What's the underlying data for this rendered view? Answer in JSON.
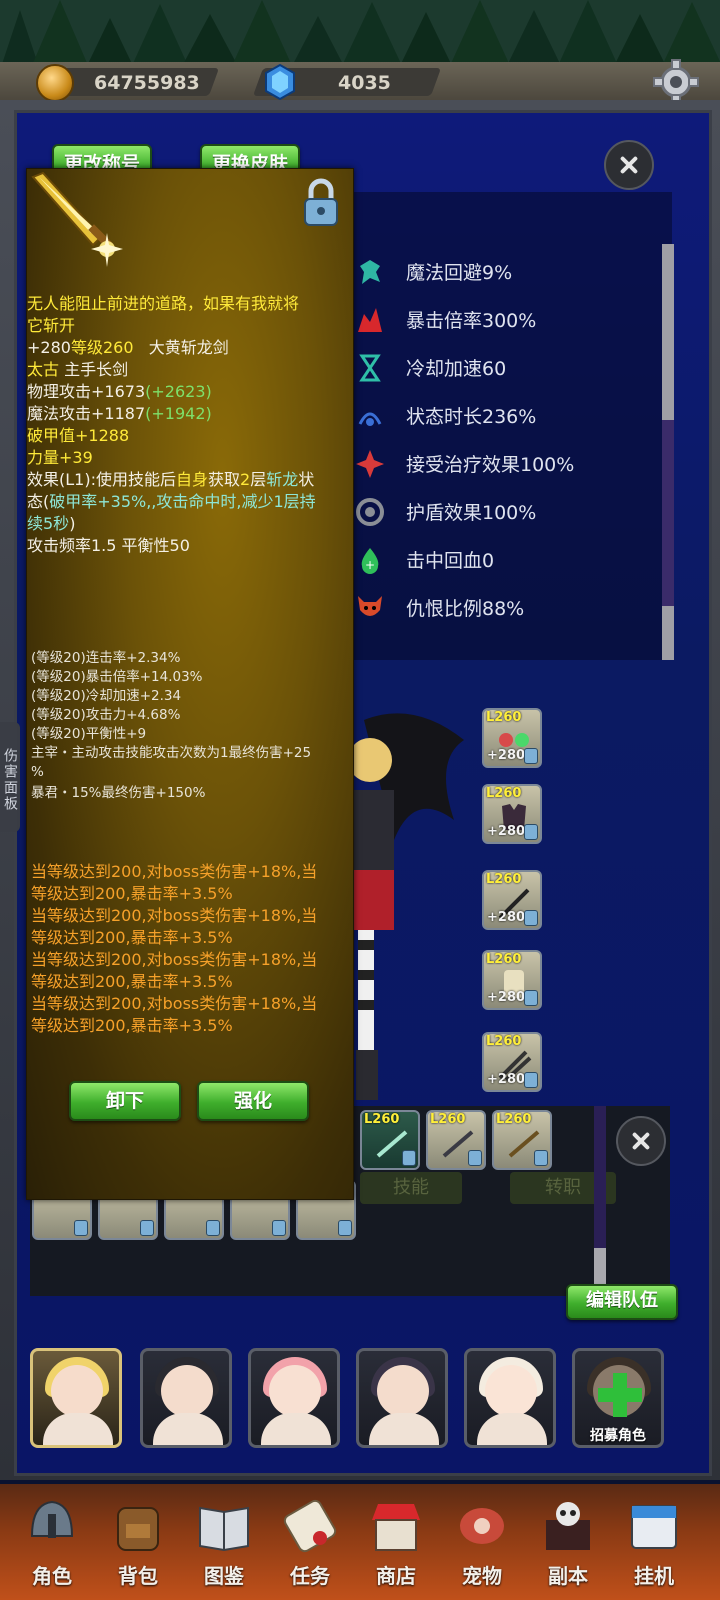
{
  "resources": {
    "gold": "64755983",
    "gems": "4035"
  },
  "side_tab": "伤害面板",
  "header_buttons": {
    "change_title": "更改称号",
    "change_skin": "更换皮肤"
  },
  "stats": [
    {
      "icon": "evade-icon",
      "label": "魔法回避9%",
      "color": "#2fb6a4"
    },
    {
      "icon": "crit-multiplier-icon",
      "label": "暴击倍率300%",
      "color": "#d8282c"
    },
    {
      "icon": "cooldown-icon",
      "label": "冷却加速60",
      "color": "#2fbfa8"
    },
    {
      "icon": "status-duration-icon",
      "label": "状态时长236%",
      "color": "#3a6fd6"
    },
    {
      "icon": "healing-received-icon",
      "label": "接受治疗效果100%",
      "color": "#d83a3a"
    },
    {
      "icon": "shield-effect-icon",
      "label": "护盾效果100%",
      "color": "#8a8e96"
    },
    {
      "icon": "life-on-hit-icon",
      "label": "击中回血0",
      "color": "#2fbf5a"
    },
    {
      "icon": "threat-ratio-icon",
      "label": "仇恨比例88%",
      "color": "#d84a2a"
    }
  ],
  "equipment_slots": [
    {
      "level": "L260",
      "plus": "+280"
    },
    {
      "level": "L260",
      "plus": "+280"
    },
    {
      "level": "L260",
      "plus": "+280"
    },
    {
      "level": "L260",
      "plus": "+280"
    },
    {
      "level": "L260",
      "plus": "+280"
    }
  ],
  "weapon_slots": [
    {
      "level": "L260"
    },
    {
      "level": "L260"
    },
    {
      "level": "L260"
    }
  ],
  "team_tabs": {
    "skills": "技能",
    "job_change": "转职",
    "edit_team": "编辑队伍"
  },
  "recruit_label": "招募角色",
  "tooltip": {
    "flavor_line1": "无人能阻止前进的道路，如果有我就将",
    "flavor_line2": "它斩开",
    "enhance": "+280",
    "level": "等级260",
    "name": "大黄斩龙剑",
    "rarity": "太古",
    "type": "主手长剑",
    "phys_atk": "物理攻击+1673",
    "phys_atk_bonus": "(+2623)",
    "mag_atk": "魔法攻击+1187",
    "mag_atk_bonus": "(+1942)",
    "armor_break": "破甲值+1288",
    "strength": "力量+39",
    "effect_a": "效果(L1):使用技能后",
    "effect_self": "自身",
    "effect_b": "获取",
    "effect_num": "2",
    "effect_c": "层",
    "effect_buff": "斩龙",
    "effect_d": "状",
    "effect_e": "态(",
    "effect_f": "破甲率+35%,,攻击命中时,减少1层持",
    "effect_g": "续5秒",
    "effect_h": ")",
    "speed_balance": "攻击频率1.5 平衡性50",
    "affixes": [
      "(等级20)连击率+2.34%",
      "(等级20)暴击倍率+14.03%",
      "(等级20)冷却加速+2.34",
      "(等级20)攻击力+4.68%",
      "(等级20)平衡性+9",
      "主宰・主动攻击技能攻击次数为1最终伤害+25",
      "%",
      "暴君・15%最终伤害+150%"
    ],
    "set_bonus": [
      "当等级达到200,对boss类伤害+18%,当",
      "等级达到200,暴击率+3.5%",
      "当等级达到200,对boss类伤害+18%,当",
      "等级达到200,暴击率+3.5%",
      "当等级达到200,对boss类伤害+18%,当",
      "等级达到200,暴击率+3.5%",
      "当等级达到200,对boss类伤害+18%,当",
      "等级达到200,暴击率+3.5%"
    ],
    "unequip": "卸下",
    "enhance_button": "强化"
  },
  "nav": [
    {
      "label": "角色",
      "icon": "helmet-icon"
    },
    {
      "label": "背包",
      "icon": "backpack-icon"
    },
    {
      "label": "图鉴",
      "icon": "book-icon"
    },
    {
      "label": "任务",
      "icon": "scroll-icon"
    },
    {
      "label": "商店",
      "icon": "shop-icon"
    },
    {
      "label": "宠物",
      "icon": "meat-icon"
    },
    {
      "label": "副本",
      "icon": "skull-castle-icon"
    },
    {
      "label": "挂机",
      "icon": "calendar-icon"
    }
  ]
}
